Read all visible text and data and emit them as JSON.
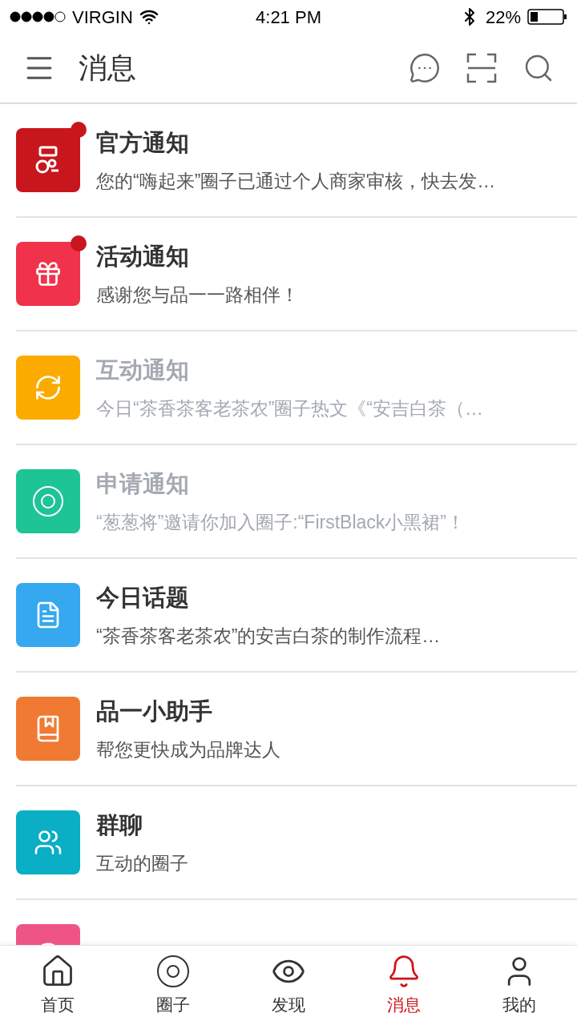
{
  "status_bar": {
    "carrier": "VIRGIN",
    "time": "4:21 PM",
    "battery": "22%"
  },
  "header": {
    "title": "消息"
  },
  "messages": [
    {
      "kind": "official",
      "title": "官方通知",
      "preview": "您的“嗨起来”圈子已通过个人商家审核，快去发…",
      "color": "#c8161d",
      "unread": true,
      "dimmed": false
    },
    {
      "kind": "gift",
      "title": "活动通知",
      "preview": "感谢您与品一一路相伴！",
      "color": "#f0324b",
      "unread": true,
      "dimmed": false
    },
    {
      "kind": "refresh",
      "title": "互动通知",
      "preview": "今日“茶香茶客老茶农”圈子热文《“安吉白茶（…",
      "color": "#fbab00",
      "unread": false,
      "dimmed": true
    },
    {
      "kind": "target",
      "title": "申请通知",
      "preview": "“葱葱将”邀请你加入圈子:“FirstBlack小黑裙”！",
      "color": "#1ec495",
      "unread": false,
      "dimmed": true
    },
    {
      "kind": "document",
      "title": "今日话题",
      "preview": "“茶香茶客老茶农”的安吉白茶的制作流程…",
      "color": "#35a8f0",
      "unread": false,
      "dimmed": false
    },
    {
      "kind": "book",
      "title": "品一小助手",
      "preview": "帮您更快成为品牌达人",
      "color": "#f07a32",
      "unread": false,
      "dimmed": false
    },
    {
      "kind": "group",
      "title": "群聊",
      "preview": "互动的圈子",
      "color": "#0aaec5",
      "unread": false,
      "dimmed": false
    },
    {
      "kind": "chat",
      "color": "#ee5585"
    }
  ],
  "tabs": [
    {
      "kind": "home",
      "label": "首页",
      "selected": false
    },
    {
      "kind": "circle",
      "label": "圈子",
      "selected": false
    },
    {
      "kind": "eye",
      "label": "发现",
      "selected": false
    },
    {
      "kind": "bell",
      "label": "消息",
      "selected": true
    },
    {
      "kind": "user",
      "label": "我的",
      "selected": false
    }
  ]
}
